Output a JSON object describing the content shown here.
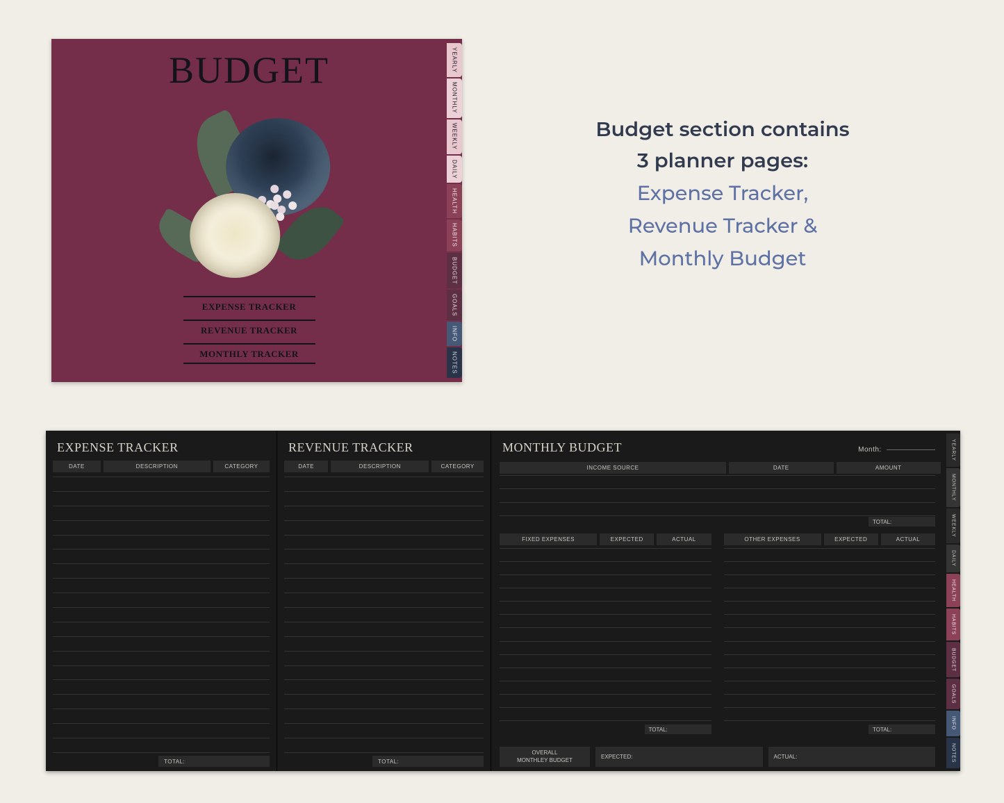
{
  "cover": {
    "title": "BUDGET",
    "links": [
      "EXPENSE TRACKER",
      "REVENUE TRACKER",
      "MONTHLY TRACKER"
    ],
    "tabs": [
      {
        "label": "YEARLY",
        "cls": "light"
      },
      {
        "label": "MONTHLY",
        "cls": "blush"
      },
      {
        "label": "WEEKLY",
        "cls": "light"
      },
      {
        "label": "DAILY",
        "cls": "blush"
      },
      {
        "label": "HEALTH",
        "cls": "mauve"
      },
      {
        "label": "HABITS",
        "cls": "mauve"
      },
      {
        "label": "BUDGET",
        "cls": "wine"
      },
      {
        "label": "GOALS",
        "cls": "wine"
      },
      {
        "label": "INFO",
        "cls": "slate"
      },
      {
        "label": "NOTES",
        "cls": "dark"
      }
    ]
  },
  "description": {
    "line1a": "Budget section contains",
    "line1b": "3 planner pages:",
    "line2a": "Expense Tracker,",
    "line2b": "Revenue Tracker &",
    "line2c": "Monthly Budget"
  },
  "pages": {
    "expense": {
      "title": "EXPENSE TRACKER",
      "columns": [
        "DATE",
        "DESCRIPTION",
        "CATEGORY"
      ],
      "total_label": "TOTAL:"
    },
    "revenue": {
      "title": "REVENUE TRACKER",
      "columns": [
        "DATE",
        "DESCRIPTION",
        "CATEGORY"
      ],
      "total_label": "TOTAL:"
    },
    "monthly": {
      "title": "MONTHLY BUDGET",
      "month_label": "Month:",
      "top_columns": [
        "INCOME SOURCE",
        "DATE",
        "AMOUNT"
      ],
      "top_total_label": "TOTAL:",
      "fixed_columns": [
        "FIXED EXPENSES",
        "EXPECTED",
        "ACTUAL"
      ],
      "other_columns": [
        "OTHER EXPENSES",
        "EXPECTED",
        "ACTUAL"
      ],
      "col_total_label": "TOTAL:",
      "footer": {
        "overall_line1": "OVERALL",
        "overall_line2": "MONTHLEY BUDGET",
        "expected_label": "EXPECTED:",
        "actual_label": "ACTUAL:"
      }
    }
  },
  "strip_tabs": [
    {
      "label": "YEARLY",
      "cls": "a"
    },
    {
      "label": "MONTHLY",
      "cls": "b"
    },
    {
      "label": "WEEKLY",
      "cls": "a"
    },
    {
      "label": "DAILY",
      "cls": "b"
    },
    {
      "label": "HEALTH",
      "cls": "m"
    },
    {
      "label": "HABITS",
      "cls": "m"
    },
    {
      "label": "BUDGET",
      "cls": "w"
    },
    {
      "label": "GOALS",
      "cls": "w"
    },
    {
      "label": "INFO",
      "cls": "s"
    },
    {
      "label": "NOTES",
      "cls": "d"
    }
  ]
}
